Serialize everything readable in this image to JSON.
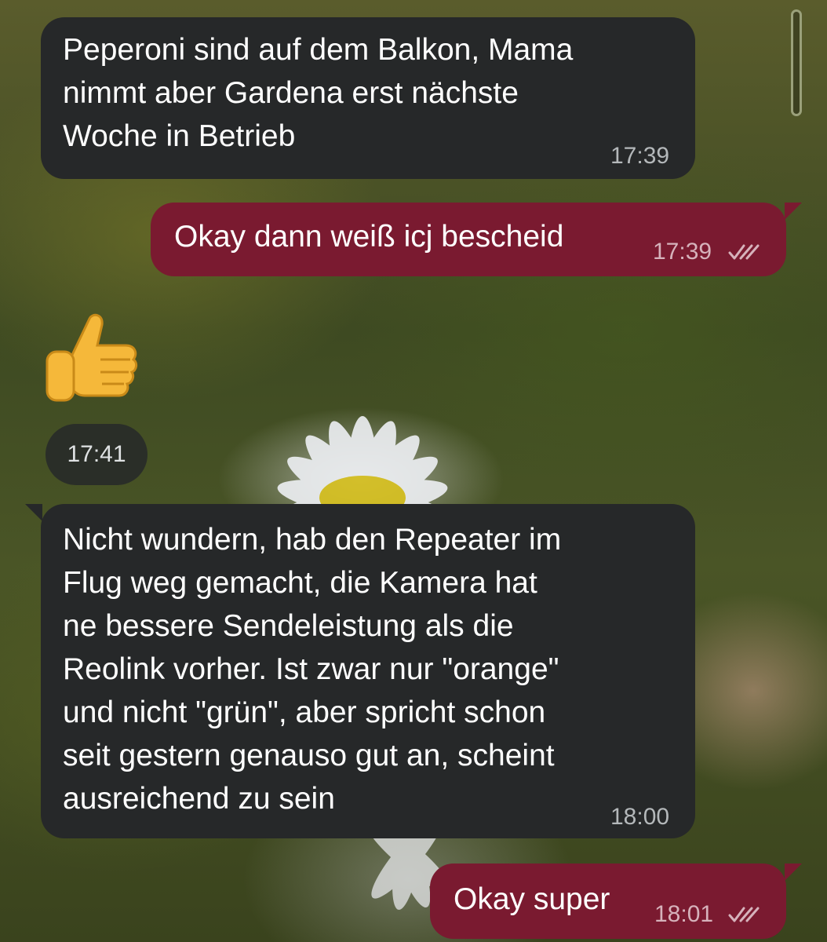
{
  "chat": {
    "messages": [
      {
        "type": "incoming",
        "text": "Peperoni sind auf dem Balkon, Mama\nnimmt aber Gardena erst nächste\nWoche in Betrieb",
        "time": "17:39"
      },
      {
        "type": "outgoing",
        "text": "Okay dann weiß icj bescheid",
        "time": "17:39",
        "status_icon": "double-check-icon"
      },
      {
        "type": "incoming-emoji",
        "emoji": "👍",
        "emoji_icon": "thumbs-up-icon",
        "time": "17:41"
      },
      {
        "type": "incoming",
        "text": "Nicht wundern, hab den Repeater im\nFlug weg gemacht, die Kamera hat\nne bessere Sendeleistung als die\nReolink vorher. Ist zwar nur \"orange\"\nund nicht \"grün\", aber spricht schon\nseit gestern genauso gut an, scheint\nausreichend zu sein",
        "time": "18:00"
      },
      {
        "type": "outgoing",
        "text": "Okay super",
        "time": "18:01",
        "status_icon": "double-check-icon"
      }
    ]
  },
  "colors": {
    "incoming_bubble": "#262829",
    "outgoing_bubble": "#7a1a30",
    "text": "#ffffff",
    "timestamp": "#b4b8ba"
  }
}
